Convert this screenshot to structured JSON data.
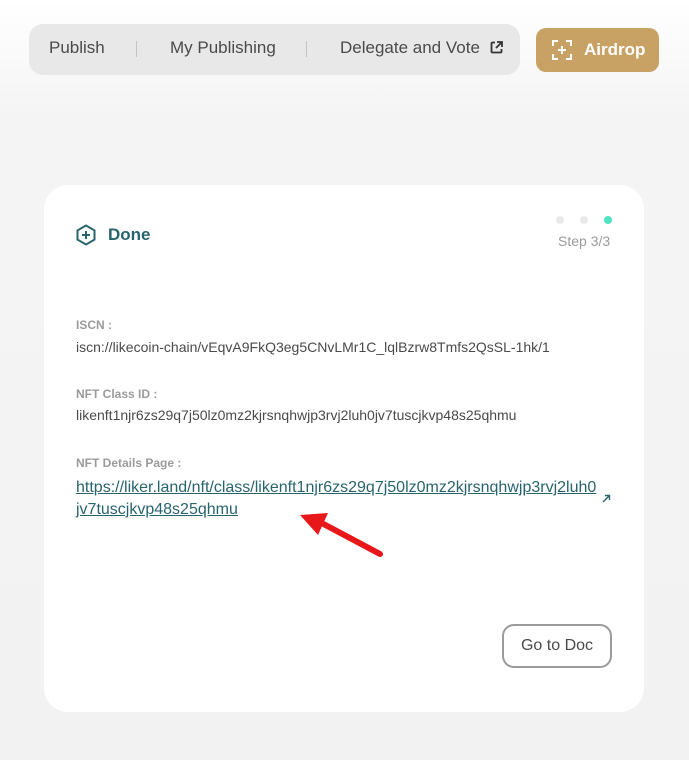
{
  "nav": {
    "items": [
      {
        "label": "Publish",
        "icon": null
      },
      {
        "label": "My Publishing",
        "icon": null
      },
      {
        "label": "Delegate and Vote",
        "icon": "external-link-icon"
      }
    ],
    "airdrop": {
      "label": "Airdrop",
      "icon": "airdrop-icon"
    }
  },
  "card": {
    "status": {
      "label": "Done",
      "icon": "plus-hexagon-icon"
    },
    "step": {
      "label": "Step 3/3",
      "current": 3,
      "total": 3
    },
    "fields": {
      "iscn": {
        "label": "ISCN :",
        "value": "iscn://likecoin-chain/vEqvA9FkQ3eg5CNvLMr1C_lqlBzrw8Tmfs2QsSL-1hk/1"
      },
      "nft_class": {
        "label": "NFT Class ID :",
        "value": "likenft1njr6zs29q7j50lz0mz2kjrsnqhwjp3rvj2luh0jv7tuscjkvp48s25qhmu"
      },
      "nft_page": {
        "label": "NFT Details Page :",
        "value": "https://liker.land/nft/class/likenft1njr6zs29q7j50lz0mz2kjrsnqhwjp3rvj2luh0jv7tuscjkvp48s25qhmu"
      }
    },
    "doc_button": "Go to Doc"
  },
  "annotation": {
    "icon": "red-arrow-icon"
  },
  "colors": {
    "accent": "#28646e",
    "gold": "#c8a165",
    "active_dot": "#50e3c2",
    "inactive_dot": "#e9e9e9",
    "annotation_red": "#e8171a"
  }
}
